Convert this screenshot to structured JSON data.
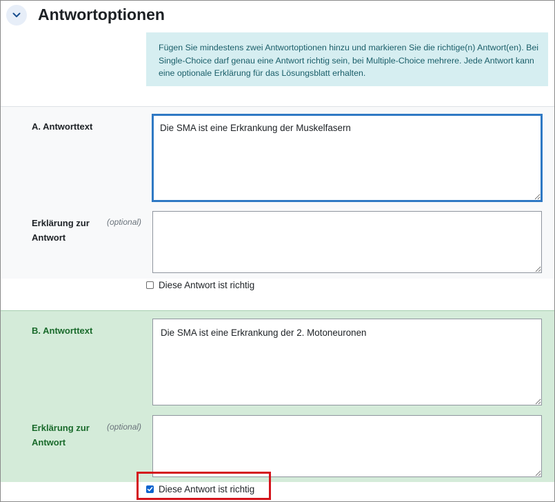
{
  "section": {
    "title": "Antwortoptionen",
    "toggle_icon": "chevron-down-icon"
  },
  "info": {
    "text": "Fügen Sie mindestens zwei Antwortoptionen hinzu und markieren Sie die richtige(n) Antwort(en). Bei Single-Choice darf genau eine Antwort richtig sein, bei Multiple-Choice mehrere. Jede Antwort kann eine optionale Erklärung für das Lösungsblatt erhalten."
  },
  "options": [
    {
      "answer_label": "A. Antworttext",
      "answer_value": "Die SMA ist eine Erkrankung der Muskelfasern",
      "explanation_label": "Erklärung zur Antwort",
      "optional": "(optional)",
      "explanation_value": "",
      "correct_label": "Diese Antwort ist richtig",
      "correct_checked": false
    },
    {
      "answer_label": "B. Antworttext",
      "answer_value": "Die SMA ist eine Erkrankung der 2. Motoneuronen",
      "explanation_label": "Erklärung zur Antwort",
      "optional": "(optional)",
      "explanation_value": "",
      "correct_label": "Diese Antwort ist richtig",
      "correct_checked": true
    }
  ],
  "colors": {
    "correct_option_bg": "#d4ebd9",
    "focus_border": "#2f79c4",
    "info_bg": "#d6eef1",
    "highlight_border": "#d4141c"
  }
}
